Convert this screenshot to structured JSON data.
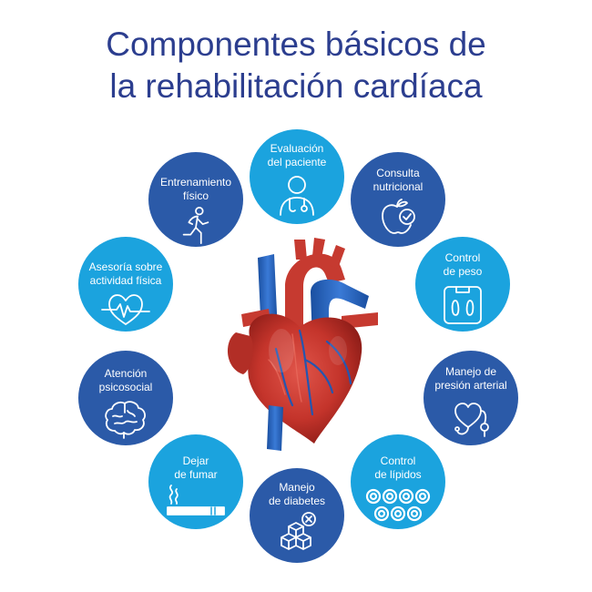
{
  "title": {
    "line1": "Componentes básicos de",
    "line2": "la rehabilitación cardíaca"
  },
  "colors": {
    "title": "#2c3e8f",
    "light_blue": "#1ba3de",
    "dark_blue": "#2b5aa8",
    "heart_red": "#c4342b",
    "vessel_blue": "#1f5fb5"
  },
  "components": [
    {
      "label": "Evaluación\ndel paciente",
      "icon": "doctor-icon"
    },
    {
      "label": "Consulta\nnutricional",
      "icon": "apple-check-icon"
    },
    {
      "label": "Control\nde peso",
      "icon": "scale-icon"
    },
    {
      "label": "Manejo de\npresión arterial",
      "icon": "blood-pressure-icon"
    },
    {
      "label": "Control\nde lípidos",
      "icon": "lipid-cells-icon"
    },
    {
      "label": "Manejo\nde diabetes",
      "icon": "sugar-cubes-icon"
    },
    {
      "label": "Dejar\nde fumar",
      "icon": "cigarette-icon"
    },
    {
      "label": "Atención\npsicosocial",
      "icon": "brain-icon"
    },
    {
      "label": "Asesoría sobre\nactividad física",
      "icon": "heart-pulse-icon"
    },
    {
      "label": "Entrenamiento\nfísico",
      "icon": "runner-icon"
    }
  ]
}
